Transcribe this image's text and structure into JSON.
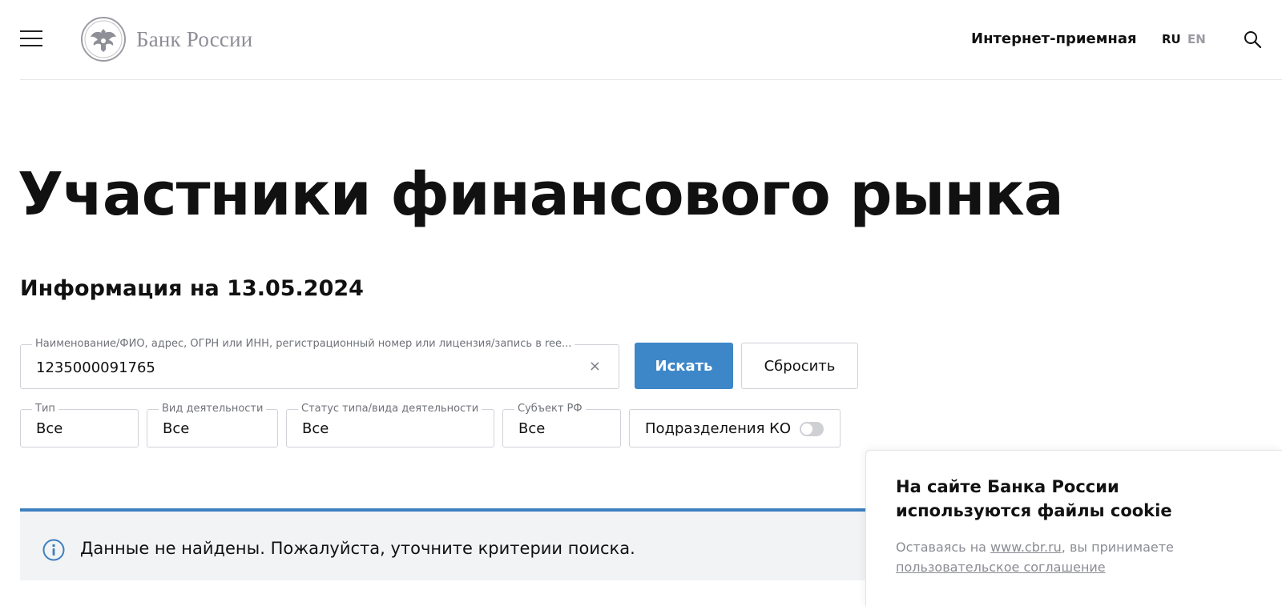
{
  "header": {
    "logo_text": "Банк России",
    "reception_link": "Интернет-приемная",
    "lang_ru": "RU",
    "lang_en": "EN"
  },
  "page": {
    "title": "Участники финансового рынка",
    "info_date": "Информация на 13.05.2024"
  },
  "search": {
    "label": "Наименование/ФИО, адрес, ОГРН или ИНН, регистрационный номер или лицензия/запись в ree...",
    "value": "1235000091765",
    "clear_symbol": "×",
    "search_button": "Искать",
    "reset_button": "Сбросить"
  },
  "filters": {
    "type": {
      "label": "Тип",
      "value": "Все"
    },
    "activity": {
      "label": "Вид деятельности",
      "value": "Все"
    },
    "status": {
      "label": "Статус типа/вида деятельности",
      "value": "Все"
    },
    "region": {
      "label": "Субъект РФ",
      "value": "Все"
    },
    "ko_divisions": {
      "label": "Подразделения КО",
      "enabled": false
    }
  },
  "notice": {
    "text": "Данные не найдены. Пожалуйста, уточните критерии поиска."
  },
  "cookie": {
    "title": "На сайте Банка России используются файлы cookie",
    "text_before": "Оставаясь на ",
    "site_link": "www.cbr.ru",
    "text_after": ", вы принимаете ",
    "agreement_link": "пользовательское соглашение"
  },
  "colors": {
    "accent": "#3d87c9",
    "notice_bar": "#3d7fbf",
    "notice_bg": "#f2f3f5",
    "logo_gray": "#8e8e97"
  },
  "icons": [
    "menu-icon",
    "bank-emblem-icon",
    "search-icon",
    "clear-icon",
    "info-icon"
  ]
}
